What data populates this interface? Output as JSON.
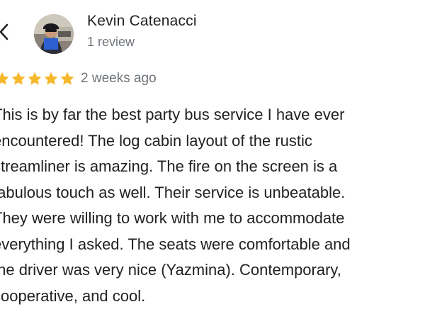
{
  "reviewer": {
    "name": "Kevin Catenacci",
    "review_count": "1 review"
  },
  "review": {
    "rating": 5,
    "rating_max": 5,
    "date": "2 weeks ago",
    "star_color": "#f6b82b",
    "lines": [
      "This is by far the best party bus service I have ever",
      "encountered! The log cabin layout of the rustic",
      "streamliner is amazing. The fire on the screen is a",
      "fabulous touch as well. Their service is unbeatable.",
      "They were willing to work with me to accommodate",
      "everything I asked. The seats were comfortable and",
      "the driver was very nice (Yazmina). Contemporary,",
      "cooperative, and cool."
    ]
  },
  "icons": {
    "back": "chevron-left-icon",
    "star": "star-icon"
  }
}
